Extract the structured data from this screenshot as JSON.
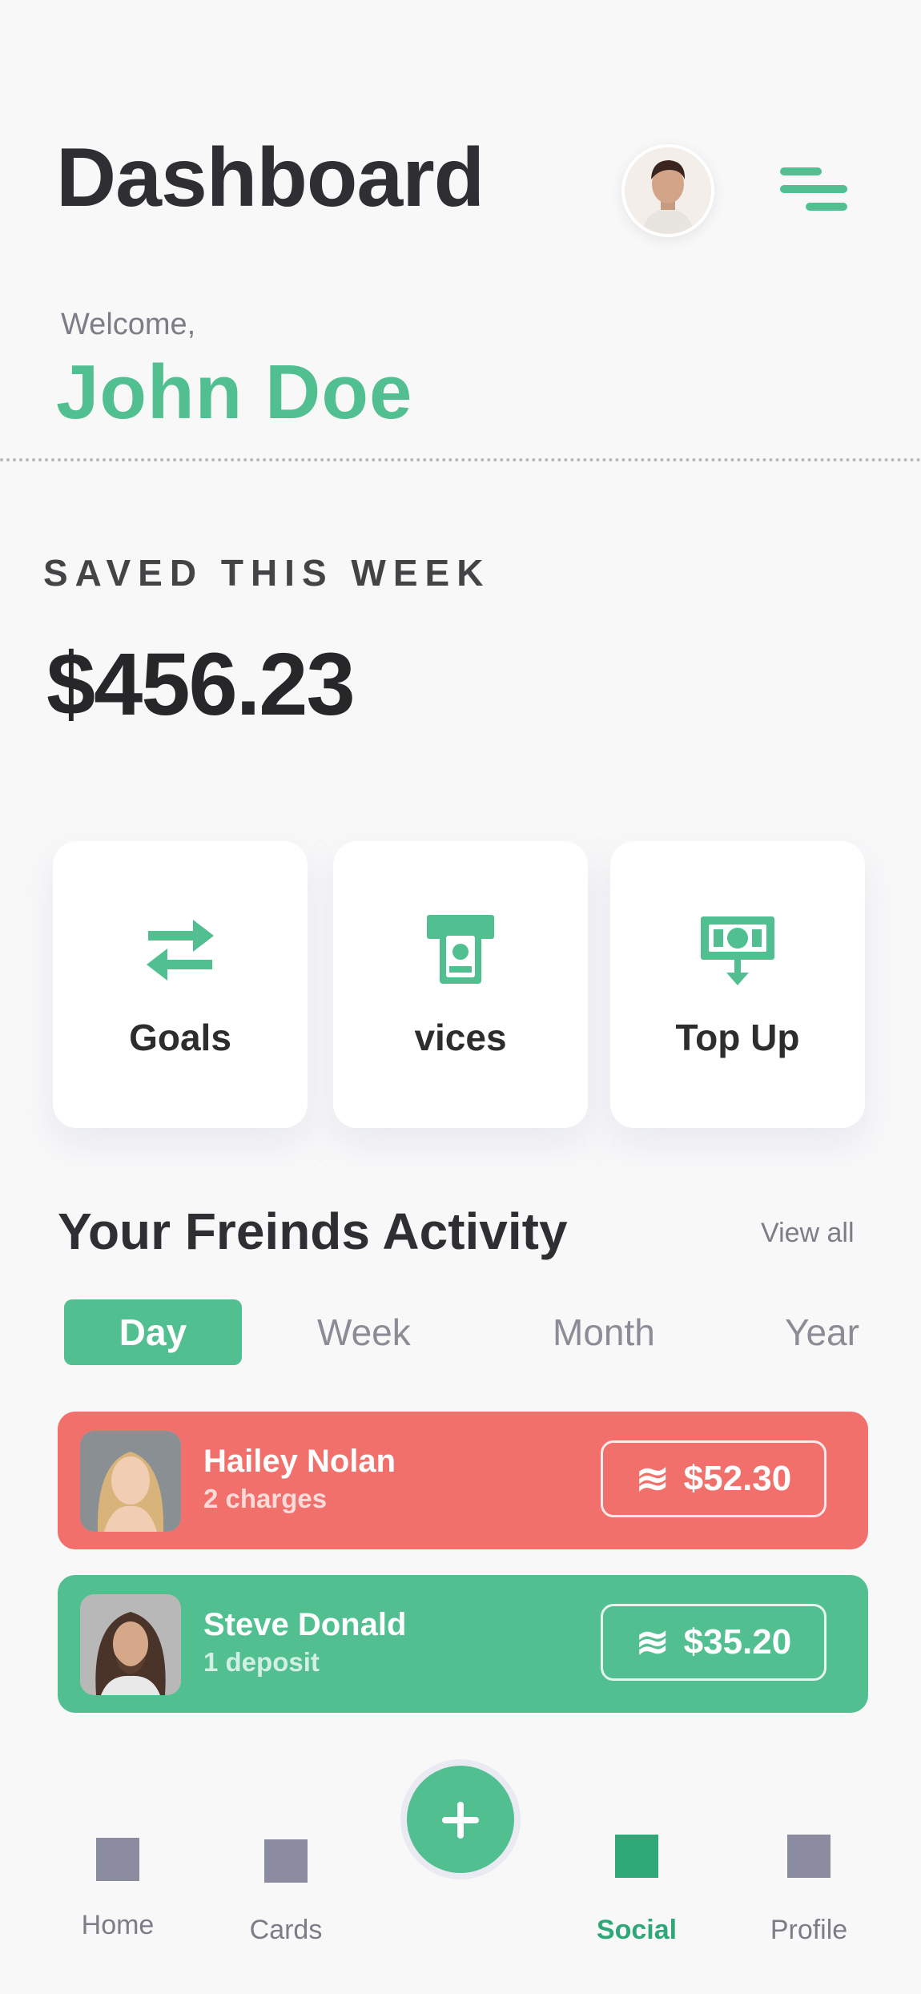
{
  "header": {
    "title": "Dashboard",
    "welcome": "Welcome,",
    "user_name": "John Doe"
  },
  "savings": {
    "label": "SAVED THIS WEEK",
    "amount": "$456.23"
  },
  "actions": [
    {
      "label": "Goals",
      "icon": "swap-arrows-icon"
    },
    {
      "label": "vices",
      "icon": "cash-withdraw-icon"
    },
    {
      "label": "Top Up",
      "icon": "cash-deposit-icon"
    }
  ],
  "activity": {
    "title": "Your Freinds Activity",
    "view_all": "View all",
    "tabs": [
      "Day",
      "Week",
      "Month",
      "Year"
    ],
    "active_tab": "Day",
    "items": [
      {
        "name": "Hailey Nolan",
        "detail": "2 charges",
        "amount": "$52.30",
        "color": "#f2706b"
      },
      {
        "name": "Steve Donald",
        "detail": "1 deposit",
        "amount": "$35.20",
        "color": "#52bf90"
      }
    ]
  },
  "nav": {
    "items": [
      "Home",
      "Cards",
      "Social",
      "Profile"
    ],
    "active": "Social"
  },
  "colors": {
    "accent": "#52bf90",
    "danger": "#f2706b",
    "nav_active": "#2fa878"
  }
}
